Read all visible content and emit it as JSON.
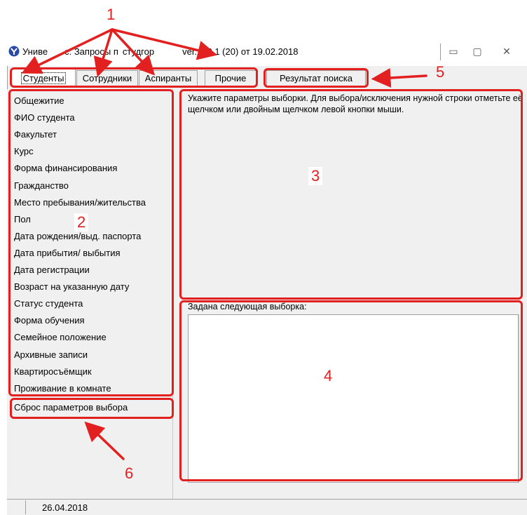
{
  "window": {
    "title": "Униве… : Запросы по студгор… ver. 1.2.1 (20) от 19.02.2018",
    "title_visible": "Униве",
    "title_mid": "с: Запросы п",
    "title_mid2": "студгор",
    "title_end": "ver. 1.2.1 (20) от 19.02.2018",
    "buttons": {
      "minimize": "▭",
      "maximize": "▢",
      "close": "✕"
    }
  },
  "tabs": [
    {
      "label": "Студенты",
      "active": true
    },
    {
      "label": "Сотрудники"
    },
    {
      "label": "Аспиранты"
    },
    {
      "label": "Прочие"
    },
    {
      "label": "Результат поиска"
    }
  ],
  "parameters": [
    "Общежитие",
    "ФИО студента",
    "Факультет",
    "Курс",
    "Форма финансирования",
    "Гражданство",
    "Место пребывания/жительства",
    "Пол",
    "Дата рождения/выд. паспорта",
    "Дата прибытия/ выбытия",
    "Дата регистрации",
    "Возраст на указанную дату",
    "Статус студента",
    "Форма обучения",
    "Семейное положение",
    "Архивные записи",
    "Квартиросъёмщик",
    "Проживание в комнате"
  ],
  "reset_button": "Сброс параметров выбора",
  "info_text": "Укажите параметры выборки. Для выбора/исключения нужной строки отметьте её щелчком или двойным щелчком левой кнопки мыши.",
  "selection_label": "Задана следующая выборка:",
  "status_date": "26.04.2018",
  "callouts": [
    "1",
    "2",
    "3",
    "4",
    "5",
    "6"
  ],
  "colors": {
    "annotation": "#e32020",
    "window_bg": "#f0f0f0",
    "app_icon": "#2a4aa8"
  }
}
